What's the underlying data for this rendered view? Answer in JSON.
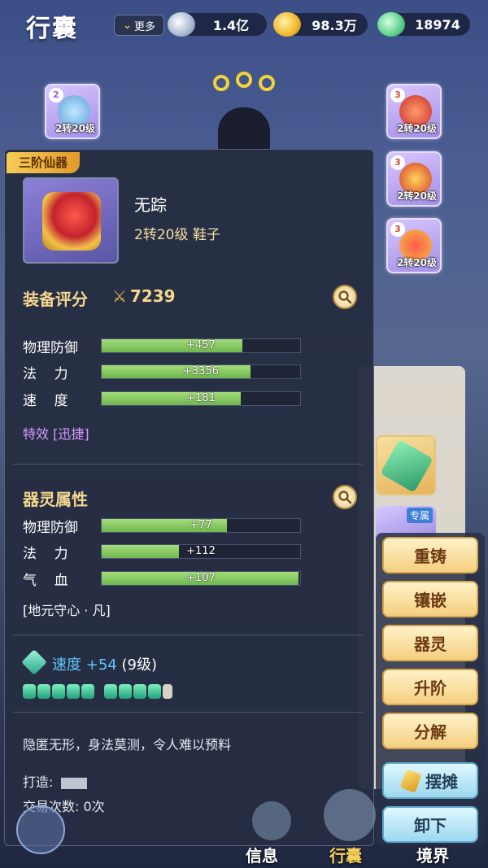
{
  "header": {
    "title": "行囊",
    "more_label": "更多",
    "currencies": [
      {
        "name": "silver-icon",
        "value": "1.4亿"
      },
      {
        "name": "gold-icon",
        "value": "98.3万"
      },
      {
        "name": "jade-icon",
        "value": "18974"
      }
    ]
  },
  "equip_slots": {
    "left": [
      {
        "level": "2",
        "label": "2转20级"
      }
    ],
    "right": [
      {
        "level": "3",
        "label": "2转20级"
      },
      {
        "level": "3",
        "label": "2转20级"
      },
      {
        "level": "3",
        "label": "2转20级"
      }
    ]
  },
  "background_item": {
    "tag": "专属"
  },
  "item": {
    "rank_badge": "三阶仙器",
    "name": "无踪",
    "subtitle": "2转20级 鞋子",
    "score_title": "装备评分",
    "score": "7239",
    "stats": [
      {
        "label": "物理防御",
        "value": "+457",
        "fill": 0.71
      },
      {
        "label": "法    力",
        "value": "+3356",
        "fill": 0.75
      },
      {
        "label": "速    度",
        "value": "+181",
        "fill": 0.7
      }
    ],
    "effect": "特效 [迅捷]",
    "soul_title": "器灵属性",
    "soul_stats": [
      {
        "label": "物理防御",
        "value": "+77",
        "fill": 0.63
      },
      {
        "label": "法    力",
        "value": "+112",
        "fill": 0.39
      },
      {
        "label": "气    血",
        "value": "+107",
        "fill": 0.99
      }
    ],
    "soul_name": "[地元守心 · 凡]",
    "speed_label": "速度",
    "speed_value": "+54",
    "speed_level": "(9级)",
    "description": "隐匿无形，身法莫测，令人难以预料",
    "maker_label": "打造:",
    "trade_label": "交易次数: 0次"
  },
  "actions": {
    "recast": "重铸",
    "inlay": "镶嵌",
    "soul": "器灵",
    "upgrade": "升阶",
    "decompose": "分解",
    "stall": "摆摊",
    "unequip": "卸下"
  },
  "bottom_nav": {
    "info": "信息",
    "bag": "行囊",
    "realm": "境界"
  },
  "colors": {
    "accent_gold": "#f5d78e",
    "stat_bar": "#8fcb64",
    "effect": "#d99cff",
    "speed": "#5cc6ff"
  }
}
